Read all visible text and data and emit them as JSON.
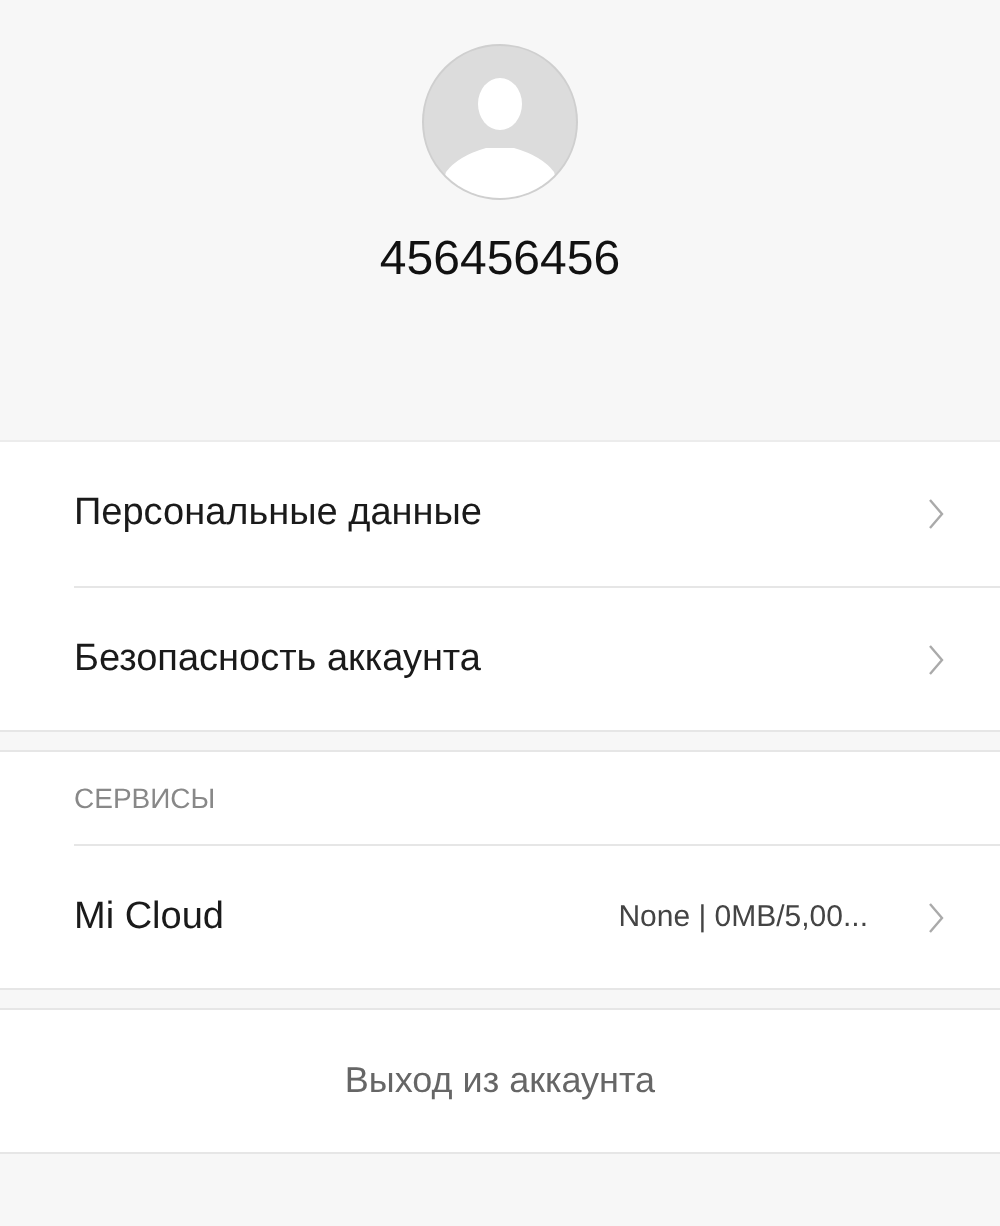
{
  "profile": {
    "username": "456456456"
  },
  "account_items": [
    {
      "label": "Персональные данные"
    },
    {
      "label": "Безопасность аккаунта"
    }
  ],
  "services": {
    "heading": "СЕРВИСЫ",
    "items": [
      {
        "label": "Mi Cloud",
        "value": "None | 0MB/5,00..."
      }
    ]
  },
  "logout_button": "Выход из аккаунта"
}
